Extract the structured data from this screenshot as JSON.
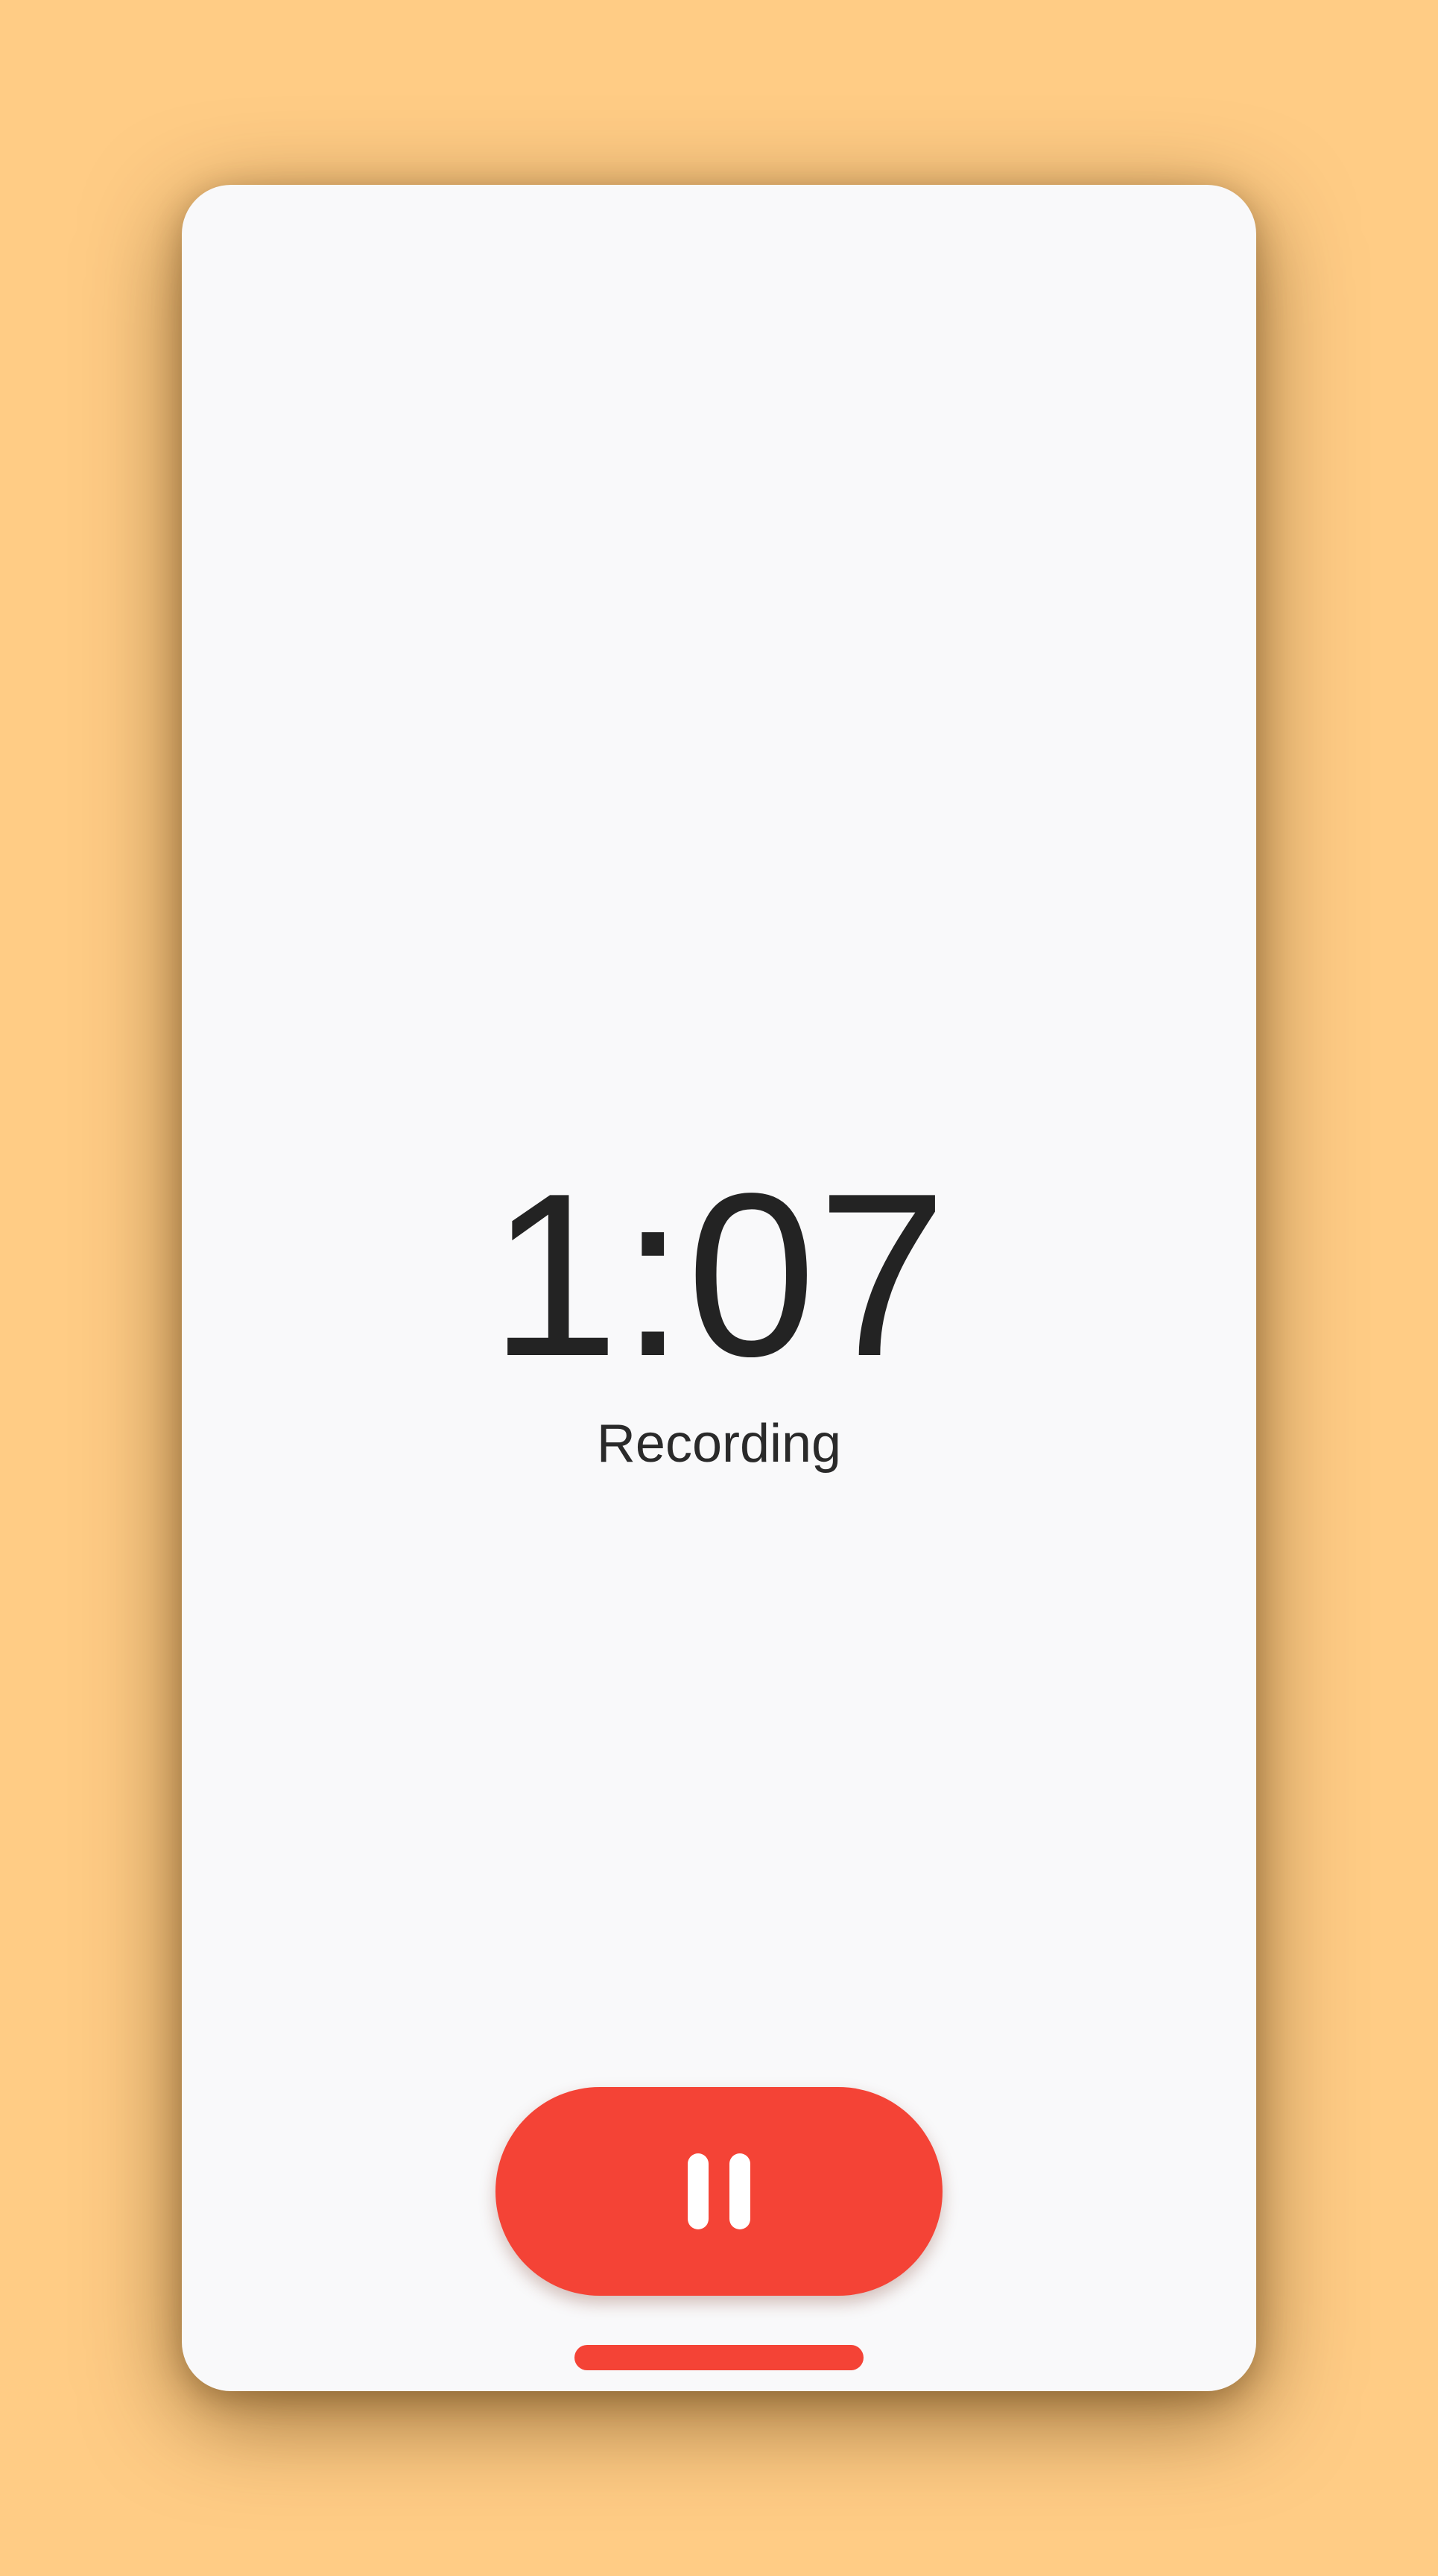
{
  "screen": {
    "timer_text": "1:07",
    "status_text": "Recording"
  },
  "controls": {
    "pause_button": {
      "icon": "pause-icon",
      "color": "#F44336"
    }
  },
  "theme": {
    "background": "#FFCC85",
    "surface": "#F9F9FA",
    "text_primary": "#232323",
    "accent": "#F44336"
  }
}
